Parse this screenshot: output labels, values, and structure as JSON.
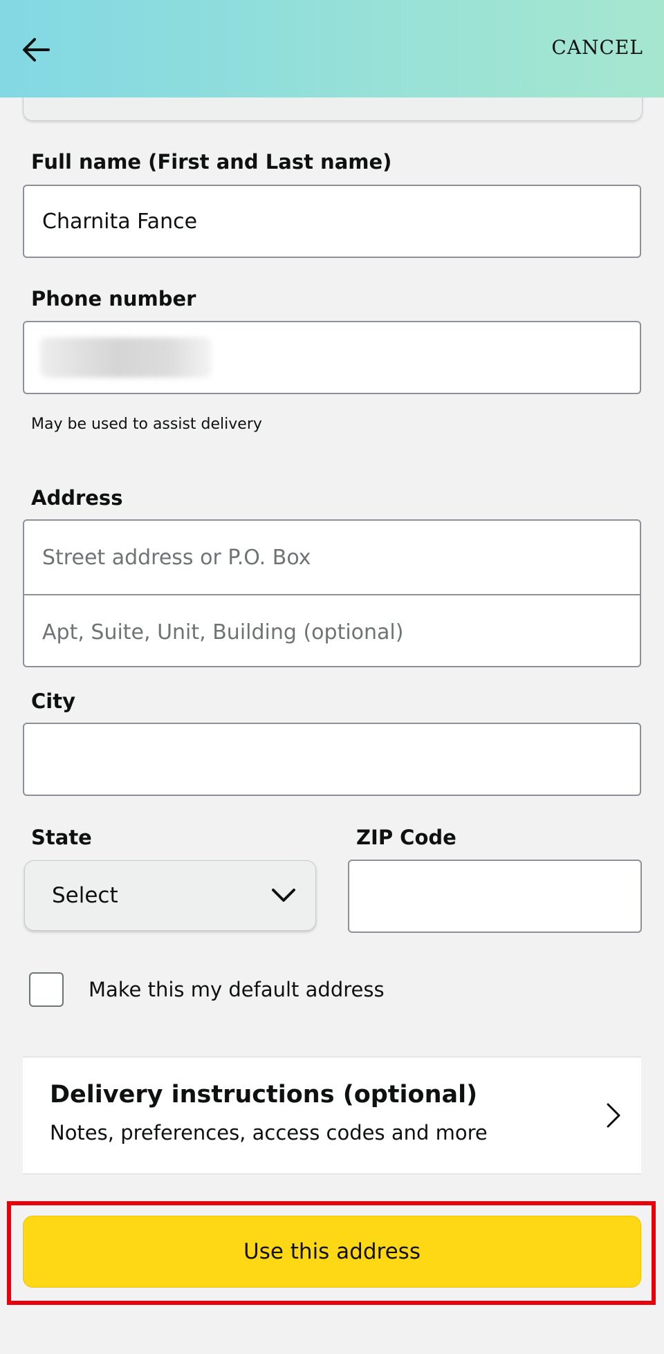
{
  "header": {
    "back_icon": "arrow-left-icon",
    "cancel_label": "CANCEL",
    "gradient_colors": [
      "#82d8e3",
      "#a6e6cf"
    ]
  },
  "form": {
    "full_name": {
      "label": "Full name (First and Last name)",
      "value": "Charnita Fance"
    },
    "phone": {
      "label": "Phone number",
      "value": "",
      "hint": "May be used to assist delivery"
    },
    "address": {
      "label": "Address",
      "line1_placeholder": "Street address or P.O. Box",
      "line2_placeholder": "Apt, Suite, Unit, Building (optional)"
    },
    "city": {
      "label": "City",
      "value": ""
    },
    "state": {
      "label": "State",
      "selected": "Select",
      "icon": "chevron-down-icon"
    },
    "zip": {
      "label": "ZIP Code",
      "value": ""
    },
    "default_address": {
      "label": "Make this my default address",
      "checked": false
    }
  },
  "delivery_instructions": {
    "title": "Delivery instructions (optional)",
    "subtitle": "Notes, preferences, access codes and more",
    "icon": "chevron-right-icon"
  },
  "submit": {
    "label": "Use this address",
    "color": "#fed814",
    "highlight_color": "#e8000b"
  }
}
